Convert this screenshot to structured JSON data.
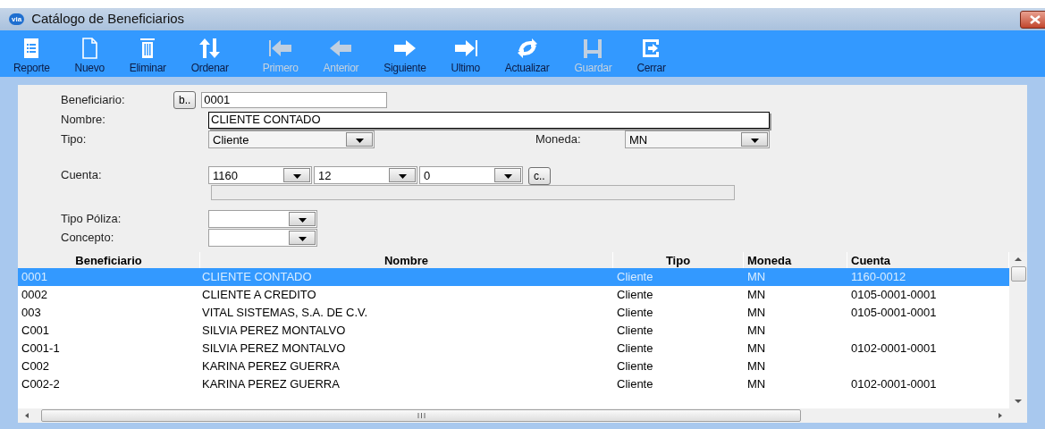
{
  "window": {
    "app_badge": "via",
    "title": "Catálogo de Beneficiarios"
  },
  "toolbar": [
    {
      "label": "Reporte",
      "disabled": false
    },
    {
      "label": "Nuevo",
      "disabled": false
    },
    {
      "label": "Eliminar",
      "disabled": false
    },
    {
      "label": "Ordenar",
      "disabled": false
    },
    {
      "label": "Primero",
      "disabled": true
    },
    {
      "label": "Anterior",
      "disabled": true
    },
    {
      "label": "Siguiente",
      "disabled": false
    },
    {
      "label": "Ultimo",
      "disabled": false
    },
    {
      "label": "Actualizar",
      "disabled": false
    },
    {
      "label": "Guardar",
      "disabled": true
    },
    {
      "label": "Cerrar",
      "disabled": false
    }
  ],
  "form": {
    "beneficiario": {
      "label": "Beneficiario:",
      "lookup_button": "b..",
      "value": "0001"
    },
    "nombre": {
      "label": "Nombre:",
      "value": "CLIENTE CONTADO"
    },
    "tipo": {
      "label": "Tipo:",
      "value": "Cliente"
    },
    "moneda": {
      "label": "Moneda:",
      "value": "MN"
    },
    "cuenta": {
      "label": "Cuenta:",
      "segments": [
        "1160",
        "12",
        "0"
      ],
      "lookup_button": "c.."
    },
    "tipo_poliza": {
      "label": "Tipo Póliza:"
    },
    "concepto": {
      "label": "Concepto:"
    }
  },
  "table": {
    "columns": [
      "Beneficiario",
      "Nombre",
      "Tipo",
      "Moneda",
      "Cuenta"
    ],
    "rows": [
      {
        "selected": true,
        "cells": [
          "0001",
          "CLIENTE CONTADO",
          "Cliente",
          "MN",
          "1160-0012"
        ]
      },
      {
        "selected": false,
        "cells": [
          "0002",
          "CLIENTE A CREDITO",
          "Cliente",
          "MN",
          "0105-0001-0001"
        ]
      },
      {
        "selected": false,
        "cells": [
          "003",
          "VITAL SISTEMAS, S.A. DE C.V.",
          "Cliente",
          "MN",
          "0105-0001-0001"
        ]
      },
      {
        "selected": false,
        "cells": [
          "C001",
          "SILVIA PEREZ MONTALVO",
          "Cliente",
          "MN",
          ""
        ]
      },
      {
        "selected": false,
        "cells": [
          "C001-1",
          "SILVIA PEREZ MONTALVO",
          "Cliente",
          "MN",
          "0102-0001-0001"
        ]
      },
      {
        "selected": false,
        "cells": [
          "C002",
          "KARINA PEREZ GUERRA",
          "Cliente",
          "MN",
          ""
        ]
      },
      {
        "selected": false,
        "cells": [
          "C002-2",
          "KARINA PEREZ GUERRA",
          "Cliente",
          "MN",
          "0102-0001-0001"
        ]
      }
    ]
  }
}
